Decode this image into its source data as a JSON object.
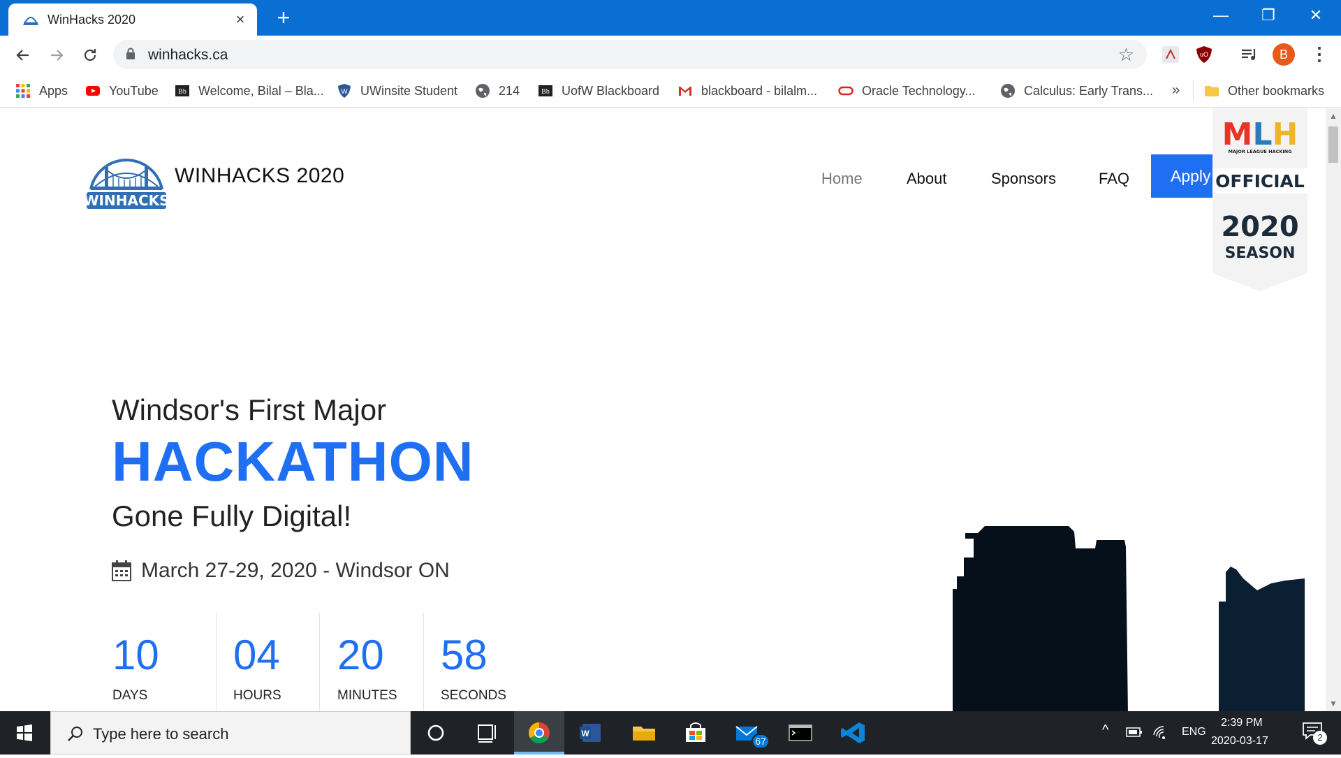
{
  "browser": {
    "tab_title": "WinHacks 2020",
    "new_tab_label": "+",
    "url": "winhacks.ca",
    "window_controls": {
      "minimize": "—",
      "restore": "❐",
      "close": "✕"
    },
    "profile_initial": "B"
  },
  "bookmarks": {
    "items": [
      {
        "label": "Apps",
        "icon": "apps-grid-icon"
      },
      {
        "label": "YouTube",
        "icon": "youtube-icon"
      },
      {
        "label": "Welcome, Bilal – Bla...",
        "icon": "blackboard-icon"
      },
      {
        "label": "UWinsite Student",
        "icon": "uwindsor-shield-icon"
      },
      {
        "label": "214",
        "icon": "globe-icon"
      },
      {
        "label": "UofW Blackboard",
        "icon": "blackboard-icon"
      },
      {
        "label": "blackboard - bilalm...",
        "icon": "gmail-icon"
      },
      {
        "label": "Oracle Technology...",
        "icon": "oracle-icon"
      },
      {
        "label": "Calculus: Early Trans...",
        "icon": "globe-icon"
      }
    ],
    "more": "»",
    "other_label": "Other bookmarks"
  },
  "site": {
    "name": "WINHACKS 2020",
    "nav": [
      {
        "label": "Home"
      },
      {
        "label": "About"
      },
      {
        "label": "Sponsors"
      },
      {
        "label": "FAQ"
      }
    ],
    "apply_label": "Apply",
    "mlh_badge": {
      "line1": "MLH",
      "line2": "MAJOR LEAGUE HACKING",
      "line3": "OFFICIAL",
      "line4": "2020",
      "line5": "SEASON"
    }
  },
  "hero": {
    "pre_title": "Windsor's First Major",
    "title": "HACKATHON",
    "subtitle": "Gone Fully Digital!",
    "date_text": "March 27-29, 2020 - Windsor ON"
  },
  "countdown": [
    {
      "value": "10",
      "label": "DAYS"
    },
    {
      "value": "04",
      "label": "HOURS"
    },
    {
      "value": "20",
      "label": "MINUTES"
    },
    {
      "value": "58",
      "label": "SECONDS"
    }
  ],
  "taskbar": {
    "search_placeholder": "Type here to search",
    "mail_badge": "67",
    "language": "ENG",
    "time": "2:39 PM",
    "date": "2020-03-17",
    "notification_count": "2"
  },
  "colors": {
    "accent": "#1f6ff2",
    "titlebar": "#0a6fd2",
    "taskbar": "#1f2226",
    "skyline": "#06121f"
  }
}
